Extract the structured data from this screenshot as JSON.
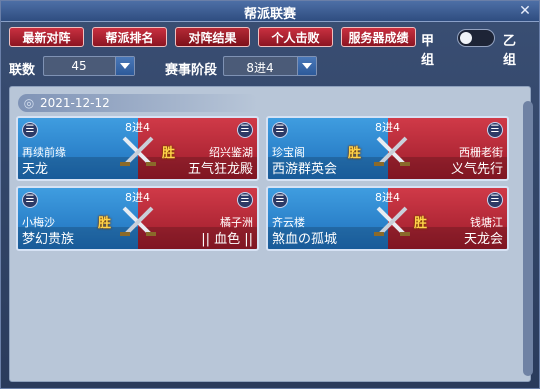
{
  "window": {
    "title": "帮派联赛",
    "close": "✕"
  },
  "tabs": [
    {
      "label": "最新对阵"
    },
    {
      "label": "帮派排名"
    },
    {
      "label": "对阵结果"
    },
    {
      "label": "个人击败"
    },
    {
      "label": "服务器成绩"
    }
  ],
  "group_toggle": {
    "left": "甲组",
    "right": "乙组"
  },
  "filters": {
    "count_label": "联数",
    "count_value": "45",
    "stage_label": "赛事阶段",
    "stage_value": "8进4"
  },
  "date": "2021-12-12",
  "matches": [
    {
      "stage": "8进4",
      "left_server": "再续前缘",
      "left_team": "天龙",
      "right_server": "绍兴鉴湖",
      "right_team": "五气狂龙殿",
      "win_mark": "胜"
    },
    {
      "stage": "8进4",
      "left_server": "珍宝阁",
      "left_team": "西游群英会",
      "right_server": "西栅老街",
      "right_team": "义气先行",
      "win_mark": "胜"
    },
    {
      "stage": "8进4",
      "left_server": "小梅沙",
      "left_team": "梦幻贵族",
      "right_server": "橘子洲",
      "right_team": "|| 血色 ||",
      "win_mark": "胜"
    },
    {
      "stage": "8进4",
      "left_server": "齐云楼",
      "left_team": "煞血の孤城",
      "right_server": "钱塘江",
      "right_team": "天龙会",
      "win_mark": "胜"
    }
  ],
  "icons": {
    "menu": "menu-icon",
    "swords": "crossed-swords-icon",
    "date": "swirl-icon"
  }
}
